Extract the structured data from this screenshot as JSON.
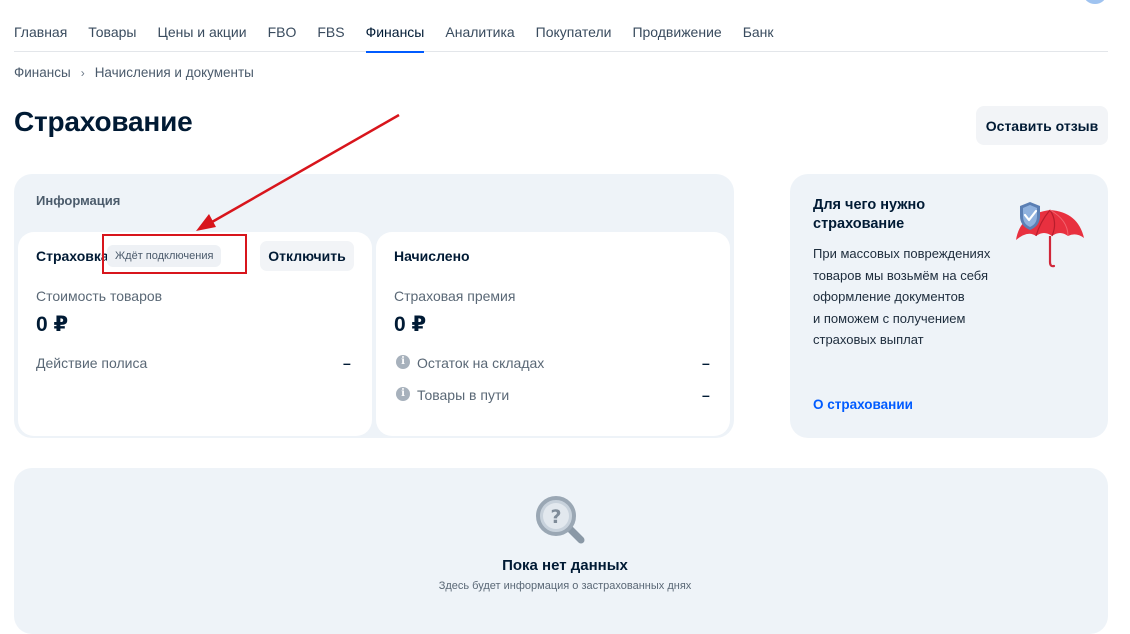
{
  "nav": {
    "items": [
      {
        "label": "Главная"
      },
      {
        "label": "Товары"
      },
      {
        "label": "Цены и акции"
      },
      {
        "label": "FBO"
      },
      {
        "label": "FBS"
      },
      {
        "label": "Финансы",
        "active": true
      },
      {
        "label": "Аналитика"
      },
      {
        "label": "Покупатели"
      },
      {
        "label": "Продвижение"
      },
      {
        "label": "Банк"
      }
    ]
  },
  "breadcrumb": {
    "items": [
      "Финансы",
      "Начисления и документы"
    ]
  },
  "page": {
    "title": "Страхование",
    "feedback_button": "Оставить отзыв"
  },
  "info_panel": {
    "title": "Информация",
    "insurance_card": {
      "label": "Страховка",
      "status_badge": "Ждёт подключения",
      "disconnect_button": "Отключить",
      "goods_cost_label": "Стоимость товаров",
      "goods_cost_value": "0 ₽",
      "policy_label": "Действие полиса",
      "policy_value": "–"
    },
    "accrued_card": {
      "label": "Начислено",
      "premium_label": "Страховая премия",
      "premium_value": "0 ₽",
      "warehouse_label": "Остаток на складах",
      "warehouse_value": "–",
      "transit_label": "Товары в пути",
      "transit_value": "–"
    }
  },
  "side_card": {
    "title": "Для чего нужно страхование",
    "text_lines": [
      "При массовых повреждениях",
      "товаров мы возьмём на себя",
      "оформление документов",
      "и поможем с получением",
      "страховых выплат"
    ],
    "link": "О страховании"
  },
  "empty_state": {
    "title": "Пока нет данных",
    "subtitle": "Здесь будет информация о застрахованных днях"
  },
  "colors": {
    "accent": "#005bff",
    "highlight": "#d8151c",
    "panel_bg": "#eef3f8"
  },
  "icons": {
    "umbrella": "umbrella-shield-icon",
    "search": "magnifier-question-icon",
    "info": "info-icon"
  }
}
